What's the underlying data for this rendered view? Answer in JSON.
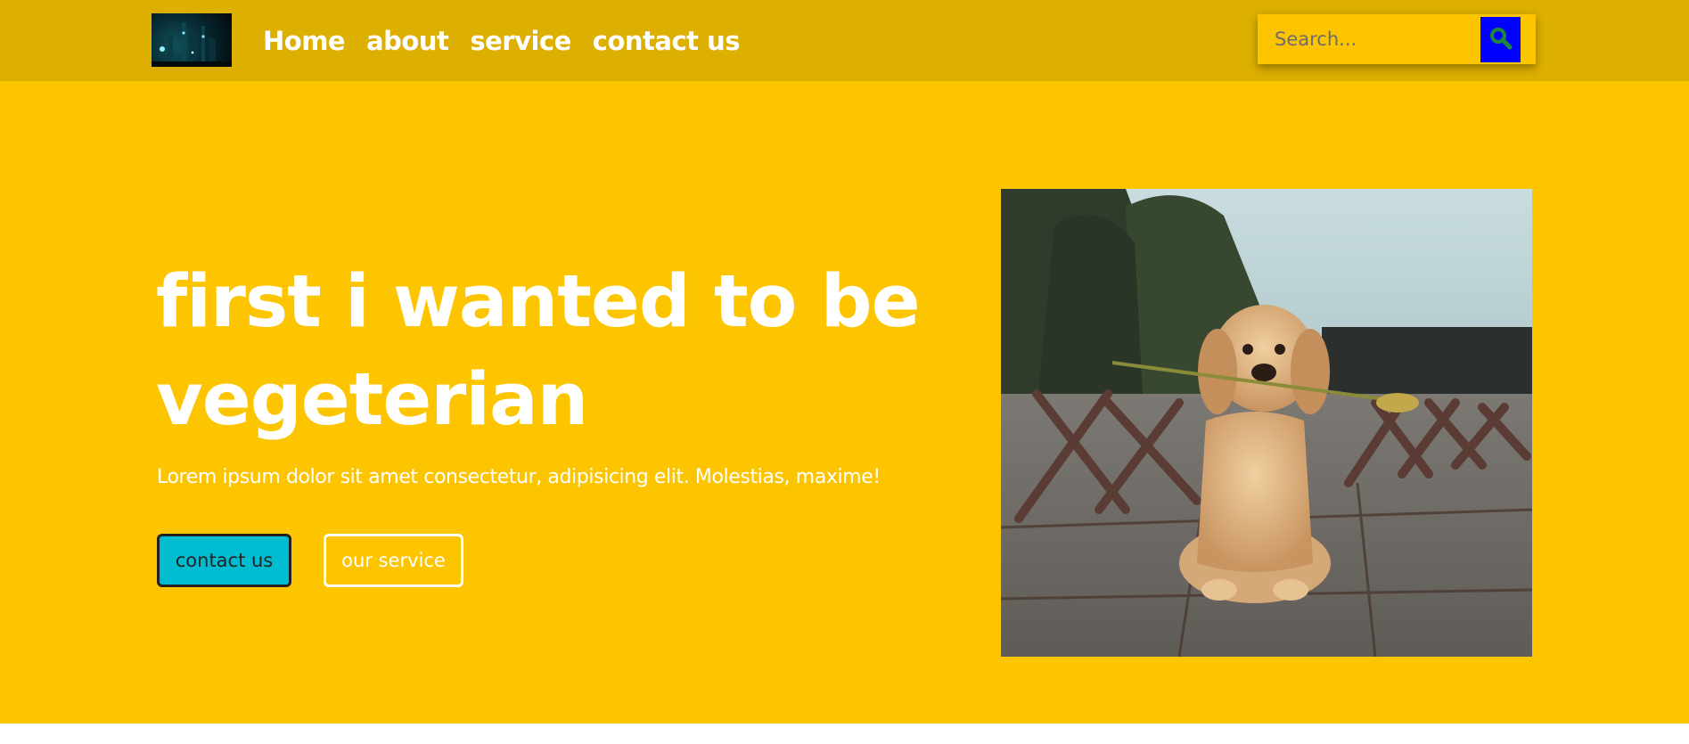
{
  "nav": {
    "logo_icon": "night-city-logo-icon",
    "links": [
      {
        "label": "Home"
      },
      {
        "label": "about"
      },
      {
        "label": "service"
      },
      {
        "label": "contact us"
      }
    ],
    "search": {
      "placeholder": "Search...",
      "button_icon": "search-icon"
    }
  },
  "hero": {
    "title": "first i wanted to be vegeterian",
    "text": "Lorem ipsum dolor sit amet consectetur, adipisicing elit. Molestias, maxime!",
    "primary_button": "contact us",
    "secondary_button": "our service",
    "image_icon": "puppy-photo-icon"
  },
  "colors": {
    "navbar": "#dcaf00",
    "hero_background": "#fdc400",
    "primary_button": "#00bcd0",
    "search_button": "#0000ff",
    "search_icon": "#1a8a3a",
    "text": "#ffffff"
  }
}
